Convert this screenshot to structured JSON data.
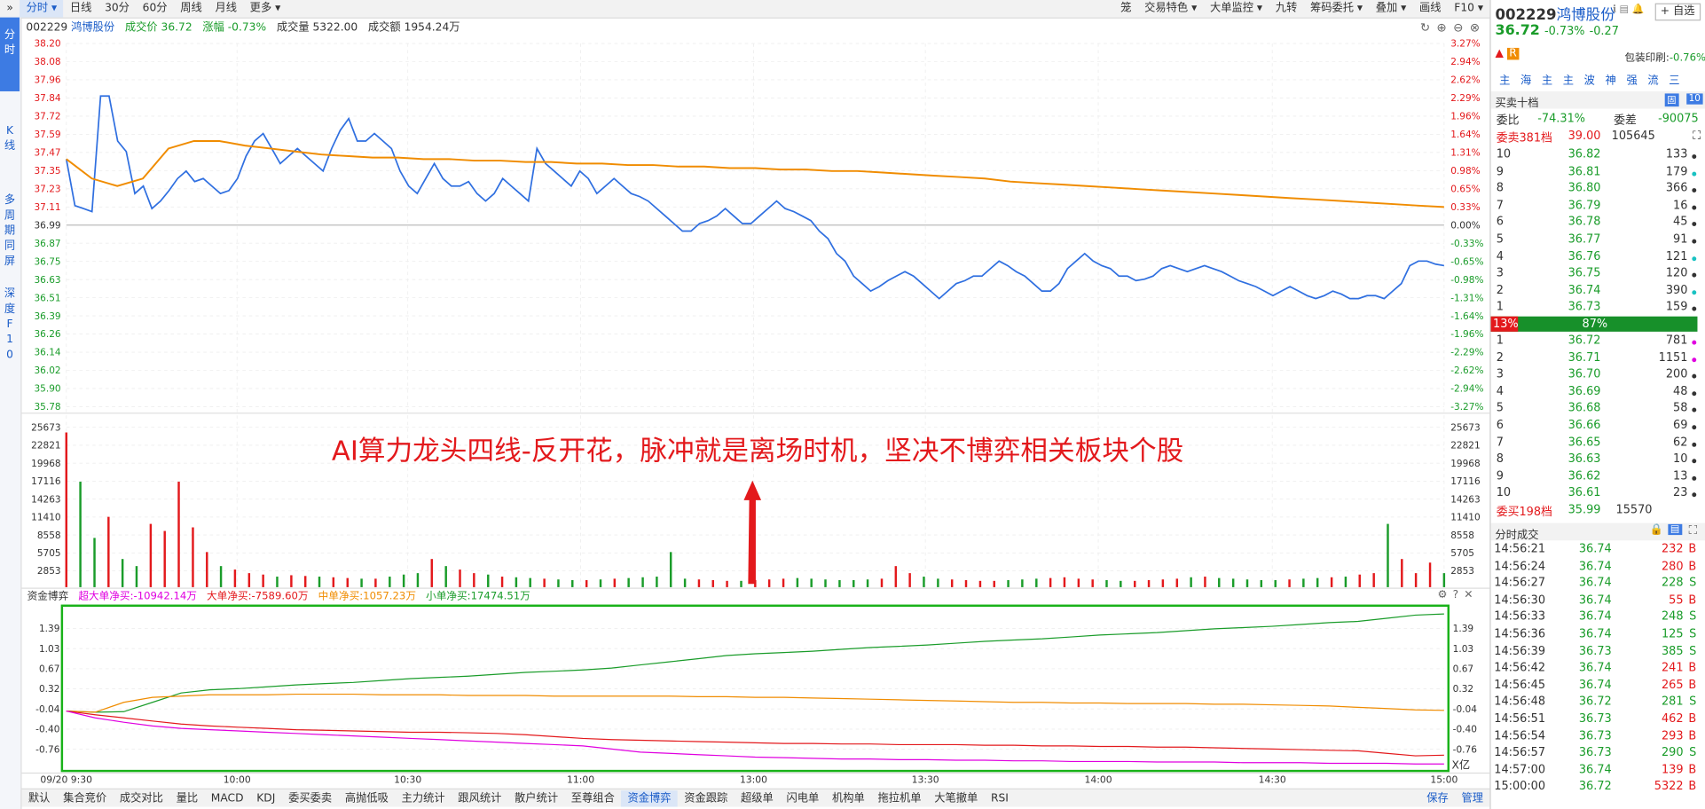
{
  "toolbar": {
    "tabs": [
      "分时",
      "日线",
      "30分",
      "60分",
      "周线",
      "月线",
      "更多"
    ],
    "right": [
      "笼",
      "交易特色",
      "大单监控",
      "九转",
      "筹码委托",
      "叠加",
      "画线",
      "F10"
    ]
  },
  "sidebar_tabs": [
    "分\n时",
    "K\n线",
    "多\n周\n期\n同\n屏",
    "深\n度\nF\n1\n0"
  ],
  "info": {
    "code": "002229",
    "name": "鸿博股份",
    "price_label": "成交价 36.72",
    "change_label": "涨幅 -0.73%",
    "volume_label": "成交量 5322.00",
    "amount_label": "成交额 1954.24万"
  },
  "left_axis": [
    "38.20",
    "38.08",
    "37.96",
    "37.84",
    "37.72",
    "37.59",
    "37.47",
    "37.35",
    "37.23",
    "37.11",
    "36.99",
    "36.87",
    "36.75",
    "36.63",
    "36.51",
    "36.39",
    "36.26",
    "36.14",
    "36.02",
    "35.90",
    "35.78"
  ],
  "right_axis": [
    "3.27%",
    "2.94%",
    "2.62%",
    "2.29%",
    "1.96%",
    "1.64%",
    "1.31%",
    "0.98%",
    "0.65%",
    "0.33%",
    "0.00%",
    "-0.33%",
    "-0.65%",
    "-0.98%",
    "-1.31%",
    "-1.64%",
    "-1.96%",
    "-2.29%",
    "-2.62%",
    "-2.94%",
    "-3.27%"
  ],
  "vol_axis": [
    "25673",
    "22821",
    "19968",
    "17116",
    "14263",
    "11410",
    "8558",
    "5705",
    "2853"
  ],
  "annotation": "AI算力龙头四线-反开花，脉冲就是离场时机，坚决不博弈相关板块个股",
  "fund": {
    "title": "资金博弈",
    "items": [
      "超大单净买:-10942.14万",
      "大单净买:-7589.60万",
      "中单净买:1057.23万",
      "小单净买:17474.51万"
    ],
    "axis": [
      "1.39",
      "1.03",
      "0.67",
      "0.32",
      "-0.04",
      "-0.40",
      "-0.76"
    ],
    "unit": "X亿"
  },
  "time_axis": [
    "09/20 9:30",
    "10:00",
    "10:30",
    "11:00",
    "13:00",
    "13:30",
    "14:00",
    "14:30",
    "15:00"
  ],
  "bottom_tabs": [
    "默认",
    "集合竞价",
    "成交对比",
    "量比",
    "MACD",
    "KDJ",
    "委买委卖",
    "高抛低吸",
    "主力统计",
    "跟风统计",
    "散户统计",
    "至尊组合",
    "资金博弈",
    "资金跟踪",
    "超级单",
    "闪电单",
    "机构单",
    "拖拉机单",
    "大笔撤单",
    "RSI"
  ],
  "bottom_right": [
    "保存",
    "管理"
  ],
  "side": {
    "code": "002229",
    "name": "鸿博股份",
    "select": "自选",
    "price": "36.72",
    "change": "-0.73%",
    "change_abs": "-0.27",
    "tag_r": "R",
    "pledge": "包装印刷:",
    "pledge_val": "-0.76%",
    "icons": [
      "主",
      "海",
      "主",
      "主",
      "波",
      "神",
      "强",
      "流",
      "三"
    ],
    "depth_title": "买卖十档",
    "depth_badges": [
      "固",
      "10"
    ],
    "ratio_label": "委比",
    "ratio_val": "-74.31%",
    "diff_label": "委差",
    "diff_val": "-90075",
    "sell_total": {
      "label": "委卖381档",
      "price": "39.00",
      "vol": "105645"
    },
    "asks": [
      {
        "lvl": "10",
        "price": "36.82",
        "vol": "133",
        "dot": "#333"
      },
      {
        "lvl": "9",
        "price": "36.81",
        "vol": "179",
        "dot": "#19c2c2"
      },
      {
        "lvl": "8",
        "price": "36.80",
        "vol": "366",
        "dot": "#333"
      },
      {
        "lvl": "7",
        "price": "36.79",
        "vol": "16",
        "dot": "#333"
      },
      {
        "lvl": "6",
        "price": "36.78",
        "vol": "45",
        "dot": "#333"
      },
      {
        "lvl": "5",
        "price": "36.77",
        "vol": "91",
        "dot": "#333"
      },
      {
        "lvl": "4",
        "price": "36.76",
        "vol": "121",
        "dot": "#19c2c2"
      },
      {
        "lvl": "3",
        "price": "36.75",
        "vol": "120",
        "dot": "#333"
      },
      {
        "lvl": "2",
        "price": "36.74",
        "vol": "390",
        "dot": "#19c2c2"
      },
      {
        "lvl": "1",
        "price": "36.73",
        "vol": "159",
        "dot": "#333"
      }
    ],
    "bar": {
      "left": "13%",
      "right": "87%",
      "left_pct": 13
    },
    "bids": [
      {
        "lvl": "1",
        "price": "36.72",
        "vol": "781",
        "dot": "#e000e0"
      },
      {
        "lvl": "2",
        "price": "36.71",
        "vol": "1151",
        "dot": "#e000e0"
      },
      {
        "lvl": "3",
        "price": "36.70",
        "vol": "200",
        "dot": "#333"
      },
      {
        "lvl": "4",
        "price": "36.69",
        "vol": "48",
        "dot": "#333"
      },
      {
        "lvl": "5",
        "price": "36.68",
        "vol": "58",
        "dot": "#333"
      },
      {
        "lvl": "6",
        "price": "36.66",
        "vol": "69",
        "dot": "#333"
      },
      {
        "lvl": "7",
        "price": "36.65",
        "vol": "62",
        "dot": "#333"
      },
      {
        "lvl": "8",
        "price": "36.63",
        "vol": "10",
        "dot": "#333"
      },
      {
        "lvl": "9",
        "price": "36.62",
        "vol": "13",
        "dot": "#333"
      },
      {
        "lvl": "10",
        "price": "36.61",
        "vol": "23",
        "dot": "#333"
      }
    ],
    "buy_total": {
      "label": "委买198档",
      "price": "35.99",
      "vol": "15570"
    },
    "ticks_title": "分时成交",
    "ticks": [
      {
        "t": "14:56:21",
        "p": "36.74",
        "v": "232",
        "s": "B"
      },
      {
        "t": "14:56:24",
        "p": "36.74",
        "v": "280",
        "s": "B"
      },
      {
        "t": "14:56:27",
        "p": "36.74",
        "v": "228",
        "s": "S"
      },
      {
        "t": "14:56:30",
        "p": "36.74",
        "v": "55",
        "s": "B"
      },
      {
        "t": "14:56:33",
        "p": "36.74",
        "v": "248",
        "s": "S"
      },
      {
        "t": "14:56:36",
        "p": "36.74",
        "v": "125",
        "s": "S"
      },
      {
        "t": "14:56:39",
        "p": "36.73",
        "v": "385",
        "s": "S"
      },
      {
        "t": "14:56:42",
        "p": "36.74",
        "v": "241",
        "s": "B"
      },
      {
        "t": "14:56:45",
        "p": "36.74",
        "v": "265",
        "s": "B"
      },
      {
        "t": "14:56:48",
        "p": "36.72",
        "v": "281",
        "s": "S"
      },
      {
        "t": "14:56:51",
        "p": "36.73",
        "v": "462",
        "s": "B"
      },
      {
        "t": "14:56:54",
        "p": "36.73",
        "v": "293",
        "s": "B"
      },
      {
        "t": "14:56:57",
        "p": "36.73",
        "v": "290",
        "s": "S"
      },
      {
        "t": "14:57:00",
        "p": "36.74",
        "v": "139",
        "s": "B"
      },
      {
        "t": "15:00:00",
        "p": "36.72",
        "v": "5322",
        "s": "B"
      }
    ]
  },
  "colors": {
    "price": "#2f6fe0",
    "avg": "#f08c00",
    "up": "#e3191c",
    "down": "#1a9c2a",
    "accent": "#1a5cc8",
    "fund_super": "#e000e0",
    "fund_big": "#e3191c",
    "fund_mid": "#f08c00",
    "fund_small": "#1a9c2a"
  },
  "chart_data": [
    {
      "type": "line",
      "title": "",
      "x_range": [
        "9:30",
        "15:00"
      ],
      "ylim": [
        35.78,
        38.2
      ],
      "series": [
        {
          "values": [
            37.43,
            37.12,
            37.1,
            37.08,
            37.85,
            37.85,
            37.55,
            37.48,
            37.2,
            37.25,
            37.1,
            37.15,
            37.22,
            37.3,
            37.35,
            37.28,
            37.3,
            37.25,
            37.2,
            37.22,
            37.3,
            37.45,
            37.55,
            37.6,
            37.5,
            37.4,
            37.45,
            37.5,
            37.45,
            37.4,
            37.35,
            37.5,
            37.62,
            37.7,
            37.55,
            37.55,
            37.6,
            37.55,
            37.5,
            37.35,
            37.25,
            37.2,
            37.3,
            37.4,
            37.3,
            37.25,
            37.25,
            37.28,
            37.2,
            37.15,
            37.2,
            37.3,
            37.25,
            37.2,
            37.15,
            37.5,
            37.4,
            37.35,
            37.3,
            37.25,
            37.35,
            37.3,
            37.2,
            37.25,
            37.3,
            37.25,
            37.2,
            37.18,
            37.15,
            37.1,
            37.05,
            37.0,
            36.95,
            36.95,
            37.0,
            37.02,
            37.05,
            37.1,
            37.05,
            37.0,
            37.0,
            37.05,
            37.1,
            37.15,
            37.1,
            37.08,
            37.05,
            37.02,
            36.95,
            36.9,
            36.8,
            36.75,
            36.65,
            36.6,
            36.55,
            36.58,
            36.62,
            36.65,
            36.68,
            36.65,
            36.6,
            36.55,
            36.5,
            36.55,
            36.6,
            36.62,
            36.65,
            36.65,
            36.7,
            36.75,
            36.72,
            36.68,
            36.65,
            36.6,
            36.55,
            36.55,
            36.6,
            36.7,
            36.75,
            36.8,
            36.75,
            36.72,
            36.7,
            36.65,
            36.65,
            36.62,
            36.63,
            36.65,
            36.7,
            36.72,
            36.7,
            36.68,
            36.7,
            36.72,
            36.7,
            36.68,
            36.65,
            36.62,
            36.6,
            36.58,
            36.55,
            36.52,
            36.55,
            36.58,
            36.55,
            36.52,
            36.5,
            36.52,
            36.55,
            36.53,
            36.5,
            36.5,
            36.52,
            36.52,
            36.5,
            36.55,
            36.6,
            36.72,
            36.75,
            36.75,
            36.73,
            36.72
          ]
        },
        {
          "values": [
            37.43,
            37.3,
            37.25,
            37.3,
            37.5,
            37.55,
            37.55,
            37.52,
            37.5,
            37.48,
            37.46,
            37.45,
            37.44,
            37.44,
            37.43,
            37.43,
            37.42,
            37.42,
            37.41,
            37.41,
            37.4,
            37.4,
            37.39,
            37.39,
            37.38,
            37.38,
            37.37,
            37.37,
            37.36,
            37.36,
            37.35,
            37.35,
            37.34,
            37.33,
            37.32,
            37.31,
            37.3,
            37.28,
            37.27,
            37.26,
            37.25,
            37.24,
            37.23,
            37.22,
            37.21,
            37.2,
            37.19,
            37.18,
            37.17,
            37.16,
            37.15,
            37.14,
            37.13,
            37.12,
            37.11
          ]
        }
      ]
    },
    {
      "type": "bar",
      "title": "",
      "ylim": [
        0,
        25673
      ],
      "values": [
        22000,
        15000,
        7000,
        10000,
        4000,
        3000,
        9000,
        8000,
        15000,
        8500,
        5000,
        3000,
        2500,
        2000,
        1800,
        1500,
        1700,
        1600,
        1500,
        1400,
        1300,
        1200,
        1200,
        1500,
        1800,
        2000,
        4000,
        3000,
        2500,
        2000,
        1800,
        1500,
        1400,
        1300,
        1200,
        1100,
        1000,
        1000,
        1100,
        1200,
        1300,
        1400,
        1500,
        5000,
        1200,
        1100,
        1000,
        900,
        900,
        1000,
        1100,
        1200,
        1300,
        1200,
        1100,
        1000,
        1000,
        1100,
        1200,
        3000,
        2000,
        1500,
        1200,
        1100,
        1000,
        900,
        900,
        1000,
        1100,
        1200,
        1300,
        1400,
        1200,
        1100,
        1000,
        900,
        900,
        1000,
        1100,
        1200,
        1400,
        1500,
        1300,
        1200,
        1100,
        1000,
        1000,
        1100,
        1200,
        1300,
        1400,
        1500,
        1800,
        2000,
        9000,
        4000,
        2000,
        3500,
        2000
      ]
    },
    {
      "type": "line",
      "title": "",
      "ylim": [
        -0.95,
        1.6
      ],
      "series": [
        {
          "values": [
            -0.04,
            -0.06,
            -0.05,
            0.1,
            0.25,
            0.3,
            0.32,
            0.35,
            0.38,
            0.4,
            0.42,
            0.45,
            0.48,
            0.5,
            0.52,
            0.55,
            0.58,
            0.6,
            0.62,
            0.65,
            0.7,
            0.75,
            0.8,
            0.85,
            0.88,
            0.9,
            0.92,
            0.95,
            0.98,
            1.0,
            1.02,
            1.05,
            1.08,
            1.1,
            1.12,
            1.15,
            1.18,
            1.2,
            1.22,
            1.25,
            1.28,
            1.3,
            1.32,
            1.35,
            1.38,
            1.4,
            1.45,
            1.5,
            1.52
          ]
        },
        {
          "values": [
            -0.04,
            -0.06,
            0.1,
            0.18,
            0.2,
            0.22,
            0.22,
            0.22,
            0.23,
            0.23,
            0.23,
            0.22,
            0.22,
            0.22,
            0.21,
            0.21,
            0.21,
            0.2,
            0.2,
            0.2,
            0.2,
            0.2,
            0.19,
            0.19,
            0.18,
            0.18,
            0.17,
            0.16,
            0.15,
            0.14,
            0.13,
            0.12,
            0.11,
            0.1,
            0.1,
            0.09,
            0.09,
            0.08,
            0.08,
            0.08,
            0.07,
            0.07,
            0.06,
            0.05,
            0.04,
            0.02,
            0.0,
            -0.02,
            -0.03
          ]
        },
        {
          "values": [
            -0.04,
            -0.1,
            -0.15,
            -0.2,
            -0.25,
            -0.28,
            -0.3,
            -0.32,
            -0.34,
            -0.35,
            -0.36,
            -0.37,
            -0.38,
            -0.38,
            -0.39,
            -0.4,
            -0.42,
            -0.45,
            -0.48,
            -0.5,
            -0.51,
            -0.52,
            -0.53,
            -0.54,
            -0.55,
            -0.56,
            -0.56,
            -0.57,
            -0.57,
            -0.58,
            -0.58,
            -0.58,
            -0.59,
            -0.59,
            -0.6,
            -0.6,
            -0.61,
            -0.61,
            -0.62,
            -0.62,
            -0.63,
            -0.64,
            -0.65,
            -0.66,
            -0.67,
            -0.68,
            -0.72,
            -0.76,
            -0.75
          ]
        },
        {
          "values": [
            -0.04,
            -0.15,
            -0.22,
            -0.28,
            -0.32,
            -0.34,
            -0.36,
            -0.38,
            -0.4,
            -0.42,
            -0.44,
            -0.46,
            -0.48,
            -0.5,
            -0.52,
            -0.54,
            -0.56,
            -0.58,
            -0.6,
            -0.65,
            -0.7,
            -0.72,
            -0.74,
            -0.76,
            -0.78,
            -0.79,
            -0.8,
            -0.81,
            -0.81,
            -0.82,
            -0.82,
            -0.83,
            -0.83,
            -0.84,
            -0.84,
            -0.85,
            -0.85,
            -0.85,
            -0.86,
            -0.86,
            -0.86,
            -0.87,
            -0.87,
            -0.87,
            -0.88,
            -0.88,
            -0.88,
            -0.89,
            -0.89
          ]
        }
      ]
    }
  ]
}
